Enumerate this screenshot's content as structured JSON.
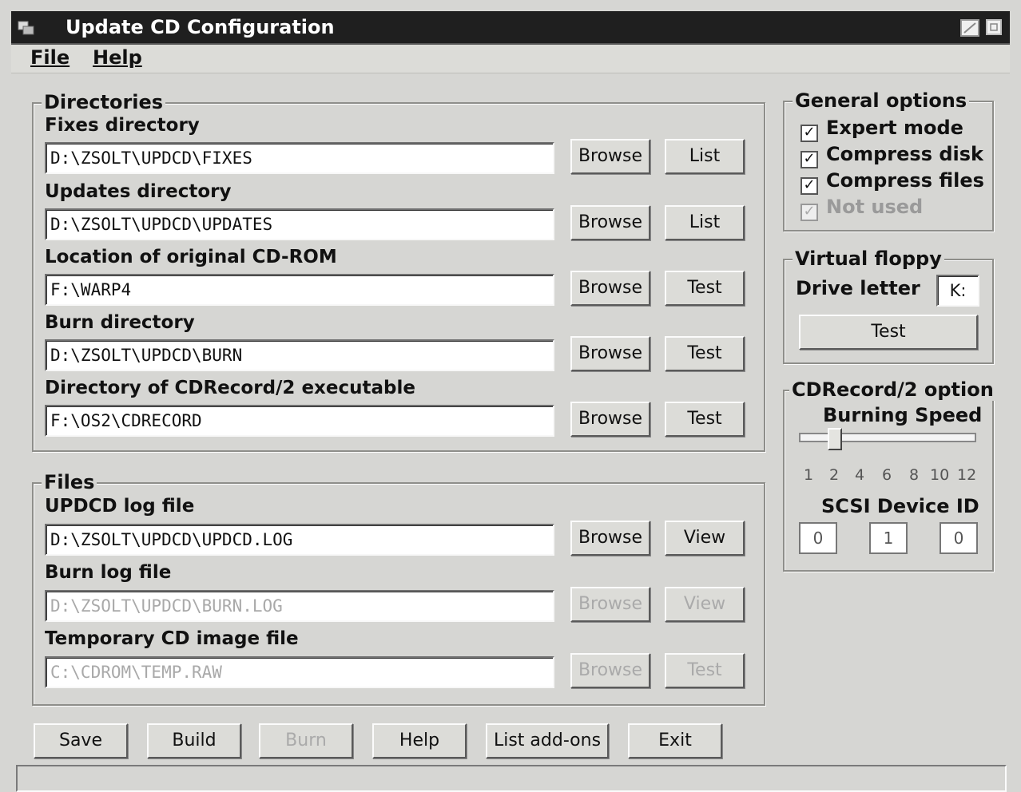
{
  "window": {
    "title": "Update CD Configuration"
  },
  "menu": {
    "file": "File",
    "help": "Help"
  },
  "directories": {
    "legend": "Directories",
    "rows": [
      {
        "label": "Fixes directory",
        "value": "D:\\ZSOLT\\UPDCD\\FIXES",
        "btn1": "Browse",
        "btn2": "List"
      },
      {
        "label": "Updates directory",
        "value": "D:\\ZSOLT\\UPDCD\\UPDATES",
        "btn1": "Browse",
        "btn2": "List"
      },
      {
        "label": "Location of original CD-ROM",
        "value": "F:\\WARP4",
        "btn1": "Browse",
        "btn2": "Test"
      },
      {
        "label": "Burn directory",
        "value": "D:\\ZSOLT\\UPDCD\\BURN",
        "btn1": "Browse",
        "btn2": "Test"
      },
      {
        "label": "Directory of CDRecord/2 executable",
        "value": "F:\\OS2\\CDRECORD",
        "btn1": "Browse",
        "btn2": "Test"
      }
    ]
  },
  "files": {
    "legend": "Files",
    "rows": [
      {
        "label": "UPDCD log file",
        "value": "D:\\ZSOLT\\UPDCD\\UPDCD.LOG",
        "btn1": "Browse",
        "btn2": "View"
      },
      {
        "label": "Burn log file",
        "value": "D:\\ZSOLT\\UPDCD\\BURN.LOG",
        "btn1": "Browse",
        "btn2": "View"
      },
      {
        "label": "Temporary CD image file",
        "value": "C:\\CDROM\\TEMP.RAW",
        "btn1": "Browse",
        "btn2": "Test"
      }
    ]
  },
  "general_options": {
    "legend": "General options",
    "items": [
      {
        "label": "Expert mode",
        "checked": true
      },
      {
        "label": "Compress disk",
        "checked": true
      },
      {
        "label": "Compress files",
        "checked": true
      },
      {
        "label": "Not used",
        "checked": true
      }
    ]
  },
  "virtual_floppy": {
    "legend": "Virtual floppy",
    "drive_label": "Drive letter",
    "drive_value": "K:",
    "test": "Test"
  },
  "cdrecord": {
    "legend": "CDRecord/2 option",
    "speed_label": "Burning Speed",
    "speed_ticks": [
      "1",
      "2",
      "4",
      "6",
      "8",
      "10",
      "12"
    ],
    "speed_value": 2,
    "scsi_label": "SCSI Device ID",
    "scsi_ids": [
      "0",
      "1",
      "0"
    ]
  },
  "buttons": {
    "save": "Save",
    "build": "Build",
    "burn": "Burn",
    "help": "Help",
    "list_addons": "List add-ons",
    "exit": "Exit"
  }
}
